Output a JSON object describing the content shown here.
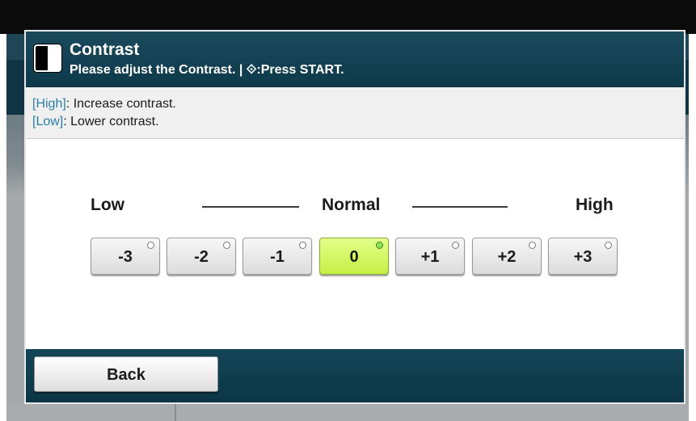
{
  "dialog": {
    "title": "Contrast",
    "subtitle": "Please adjust the Contrast. | ⟐:Press START.",
    "info": [
      {
        "key": "[High]",
        "text": ": Increase contrast."
      },
      {
        "key": "[Low]",
        "text": ": Lower contrast."
      }
    ]
  },
  "scale": {
    "low": "Low",
    "normal": "Normal",
    "high": "High"
  },
  "levels": [
    "-3",
    "-2",
    "-1",
    "0",
    "+1",
    "+2",
    "+3"
  ],
  "selected_level": "0",
  "footer": {
    "back_label": "Back"
  },
  "colors": {
    "titlebar": "#0e3a4b",
    "selected": "#c4ef45",
    "info_key": "#2a7ea6"
  }
}
